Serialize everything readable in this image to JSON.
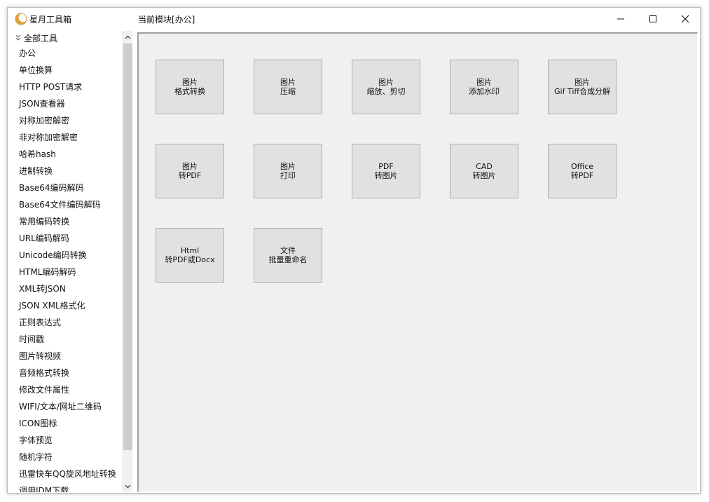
{
  "window": {
    "app_title": "星月工具箱",
    "module_title": "当前模块[办公]",
    "controls": {
      "minimize": "minimize-icon",
      "maximize": "maximize-icon",
      "close": "close-icon"
    }
  },
  "sidebar": {
    "root_label": "全部工具",
    "items": [
      "办公",
      "单位换算",
      "HTTP POST请求",
      "JSON查看器",
      "对称加密解密",
      "非对称加密解密",
      "哈希hash",
      "进制转换",
      "Base64编码解码",
      "Base64文件编码解码",
      "常用编码转换",
      "URL编码解码",
      "Unicode编码转换",
      "HTML编码解码",
      "XML转JSON",
      "JSON XML格式化",
      "正则表达式",
      "时间戳",
      "图片转视频",
      "音频格式转换",
      "修改文件属性",
      "WIFI/文本/网址二维码",
      "ICON图标",
      "字体预览",
      "随机字符",
      "迅雷快车QQ旋风地址转换",
      "调用IDM下载"
    ]
  },
  "tiles": [
    {
      "line1": "图片",
      "line2": "格式转换"
    },
    {
      "line1": "图片",
      "line2": "压缩"
    },
    {
      "line1": "图片",
      "line2": "缩放、剪切"
    },
    {
      "line1": "图片",
      "line2": "添加水印"
    },
    {
      "line1": "图片",
      "line2": "Gif Tiff合成分解"
    },
    {
      "line1": "图片",
      "line2": "转PDF"
    },
    {
      "line1": "图片",
      "line2": "打印"
    },
    {
      "line1": "PDF",
      "line2": "转图片"
    },
    {
      "line1": "CAD",
      "line2": "转图片"
    },
    {
      "line1": "Office",
      "line2": "转PDF"
    },
    {
      "line1": "Html",
      "line2": "转PDF或Docx"
    },
    {
      "line1": "文件",
      "line2": "批量重命名"
    }
  ],
  "colors": {
    "accent": "#e0a23a",
    "content_bg": "#f0f0f0",
    "tile_bg": "#e1e1e1"
  }
}
